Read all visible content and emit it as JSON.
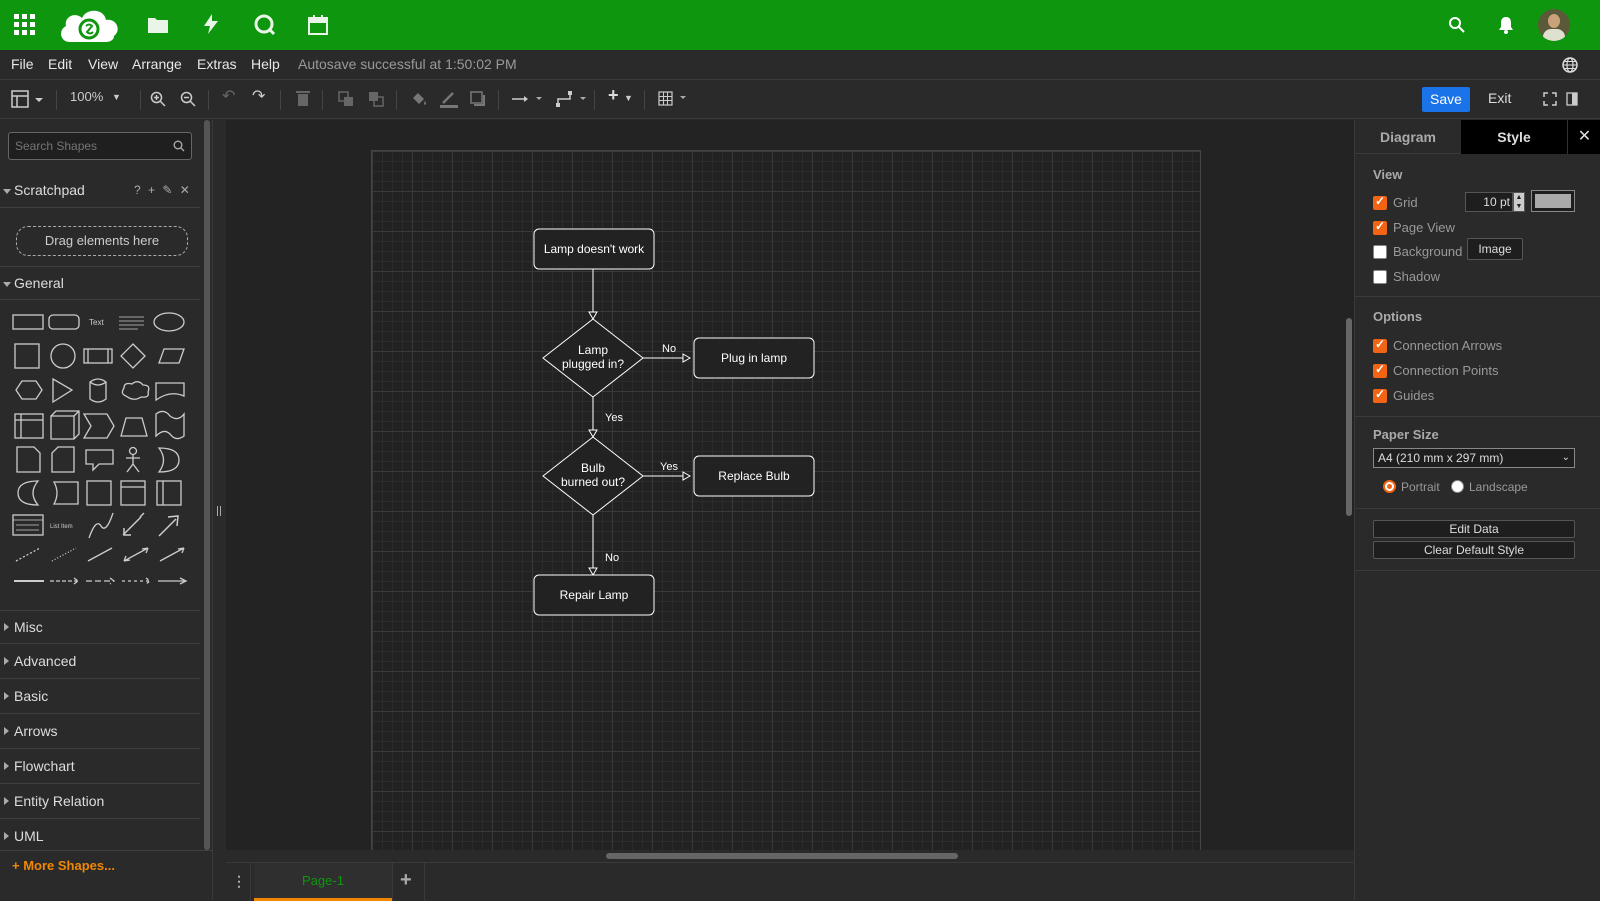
{
  "topbar": {
    "icons": [
      "apps-grid-icon",
      "cloud-logo-icon",
      "files-icon",
      "activity-icon",
      "talk-icon",
      "calendar-icon",
      "search-icon",
      "bell-icon",
      "avatar"
    ]
  },
  "menu": {
    "items": [
      "File",
      "Edit",
      "View",
      "Arrange",
      "Extras",
      "Help"
    ],
    "status": "Autosave successful at 1:50:02 PM"
  },
  "toolbar": {
    "zoom": "100%",
    "save": "Save",
    "exit": "Exit"
  },
  "left": {
    "search_placeholder": "Search Shapes",
    "scratchpad": "Scratchpad",
    "scratchpad_icons": "? + ✎ ✕",
    "drag_hint": "Drag elements here",
    "general": "General",
    "shape_text": "Text",
    "shape_list_item": "List Item",
    "sections": [
      "Misc",
      "Advanced",
      "Basic",
      "Arrows",
      "Flowchart",
      "Entity Relation",
      "UML"
    ],
    "more_shapes": "+ More Shapes..."
  },
  "diagram": {
    "nodes": {
      "start": "Lamp doesn't work",
      "q1_line1": "Lamp",
      "q1_line2": "plugged in?",
      "plug": "Plug in lamp",
      "q2_line1": "Bulb",
      "q2_line2": "burned out?",
      "replace": "Replace Bulb",
      "repair": "Repair Lamp"
    },
    "edges": {
      "q1_no": "No",
      "q1_yes": "Yes",
      "q2_yes": "Yes",
      "q2_no": "No"
    }
  },
  "pages": {
    "tab": "Page-1",
    "add": "+"
  },
  "right": {
    "tab_diagram": "Diagram",
    "tab_style": "Style",
    "close": "✕",
    "view_heading": "View",
    "grid": "Grid",
    "grid_size": "10 pt",
    "page_view": "Page View",
    "background": "Background",
    "image_btn": "Image",
    "shadow": "Shadow",
    "options_heading": "Options",
    "connection_arrows": "Connection Arrows",
    "connection_points": "Connection Points",
    "guides": "Guides",
    "paper_heading": "Paper Size",
    "paper_value": "A4 (210 mm x 297 mm)",
    "portrait": "Portrait",
    "landscape": "Landscape",
    "edit_data": "Edit Data",
    "clear_style": "Clear Default Style"
  },
  "colors": {
    "brand": "#0e970e",
    "accent": "#f08705",
    "save_button": "#1a73e8"
  }
}
